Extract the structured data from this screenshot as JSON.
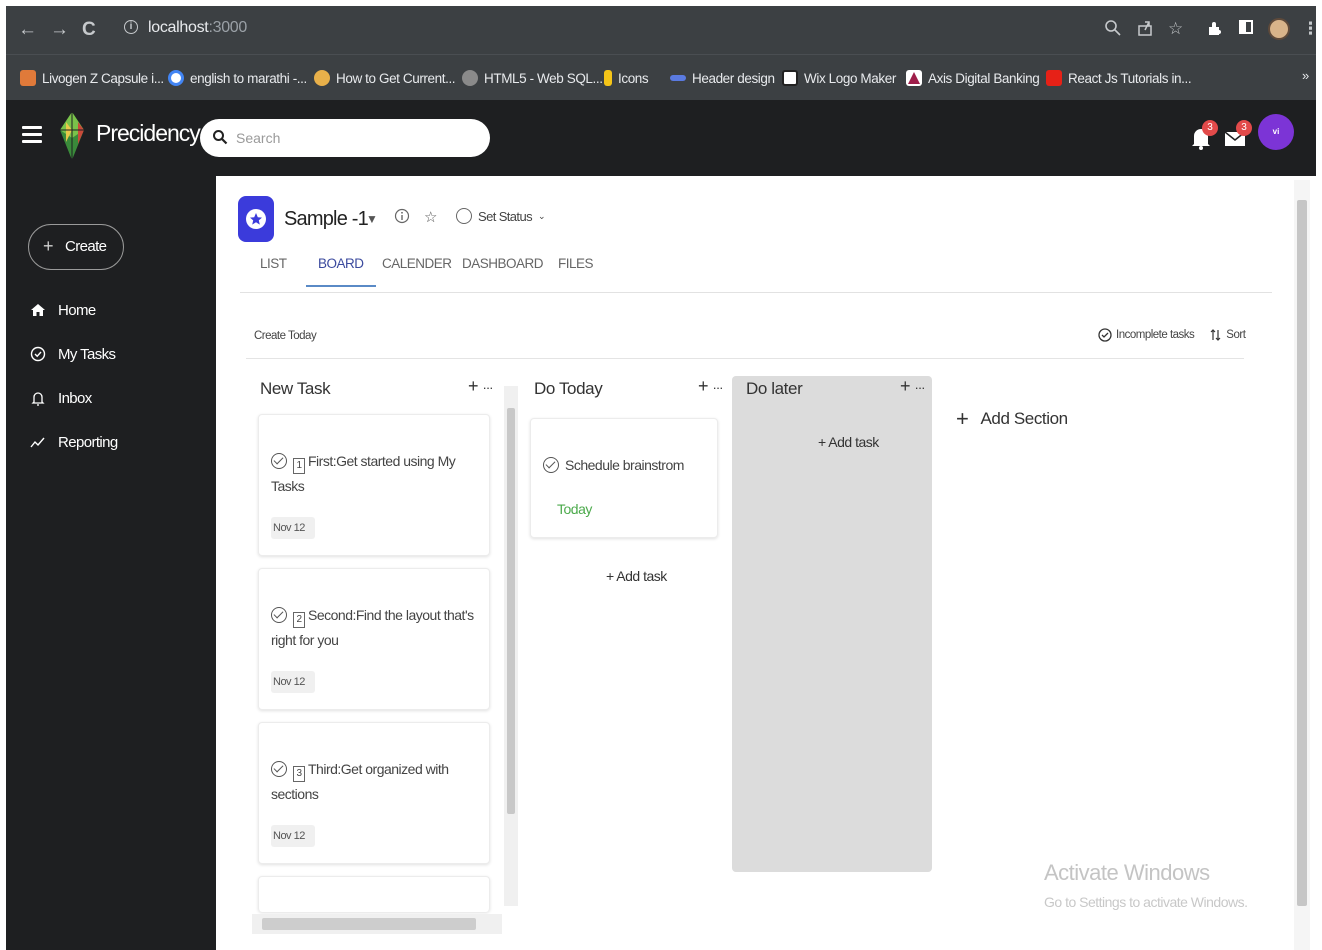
{
  "browser": {
    "url_host": "localhost",
    "url_port": ":3000",
    "bookmarks": [
      {
        "label": "Livogen Z Capsule i...",
        "color": "#e07a3a"
      },
      {
        "label": "english to marathi -...",
        "color": "#4285f4"
      },
      {
        "label": "How to Get Current...",
        "color": "#e8b04a"
      },
      {
        "label": "HTML5 - Web SQL...",
        "color": "#8a8a8a"
      },
      {
        "label": "Icons",
        "color": "#f5c518"
      },
      {
        "label": "Header design",
        "color": "#5a7ae0"
      },
      {
        "label": "Wix Logo Maker",
        "color": "#ffffff"
      },
      {
        "label": "Axis Digital Banking",
        "color": "#ffffff"
      },
      {
        "label": "React Js Tutorials in...",
        "color": "#e62117"
      }
    ],
    "more": "»"
  },
  "header": {
    "brand": "Precidency",
    "search_placeholder": "Search",
    "notifications_count": "3",
    "messages_count": "3",
    "avatar_initials": "vi",
    "accent": "#7c34d6"
  },
  "sidebar": {
    "create_label": "Create",
    "items": [
      {
        "label": "Home",
        "icon": "home-icon"
      },
      {
        "label": "My Tasks",
        "icon": "check-circle-icon"
      },
      {
        "label": "Inbox",
        "icon": "bell-icon"
      },
      {
        "label": "Reporting",
        "icon": "trend-icon"
      }
    ]
  },
  "project": {
    "title": "Sample -1",
    "set_status": "Set Status",
    "tabs": [
      "LIST",
      "BOARD",
      "CALENDER",
      "DASHBOARD",
      "FILES"
    ],
    "active_tab": "BOARD"
  },
  "toolbar": {
    "create_today": "Create Today",
    "incomplete_tasks": "Incomplete tasks",
    "sort": "Sort"
  },
  "board": {
    "columns": [
      {
        "title": "New Task",
        "cards": [
          {
            "num": "1",
            "title": "First:Get started using My Tasks",
            "date": "Nov 12"
          },
          {
            "num": "2",
            "title": "Second:Find the layout that's right for you",
            "date": "Nov 12"
          },
          {
            "num": "3",
            "title": "Third:Get organized with sections",
            "date": "Nov 12"
          }
        ]
      },
      {
        "title": "Do Today",
        "cards": [
          {
            "title": "Schedule brainstrom",
            "date_label": "Today"
          }
        ],
        "add_task": "+ Add task"
      },
      {
        "title": "Do later",
        "add_task": "+ Add task"
      }
    ],
    "add_section": "Add Section"
  },
  "watermark": {
    "line1": "Activate Windows",
    "line2": "Go to Settings to activate Windows."
  }
}
